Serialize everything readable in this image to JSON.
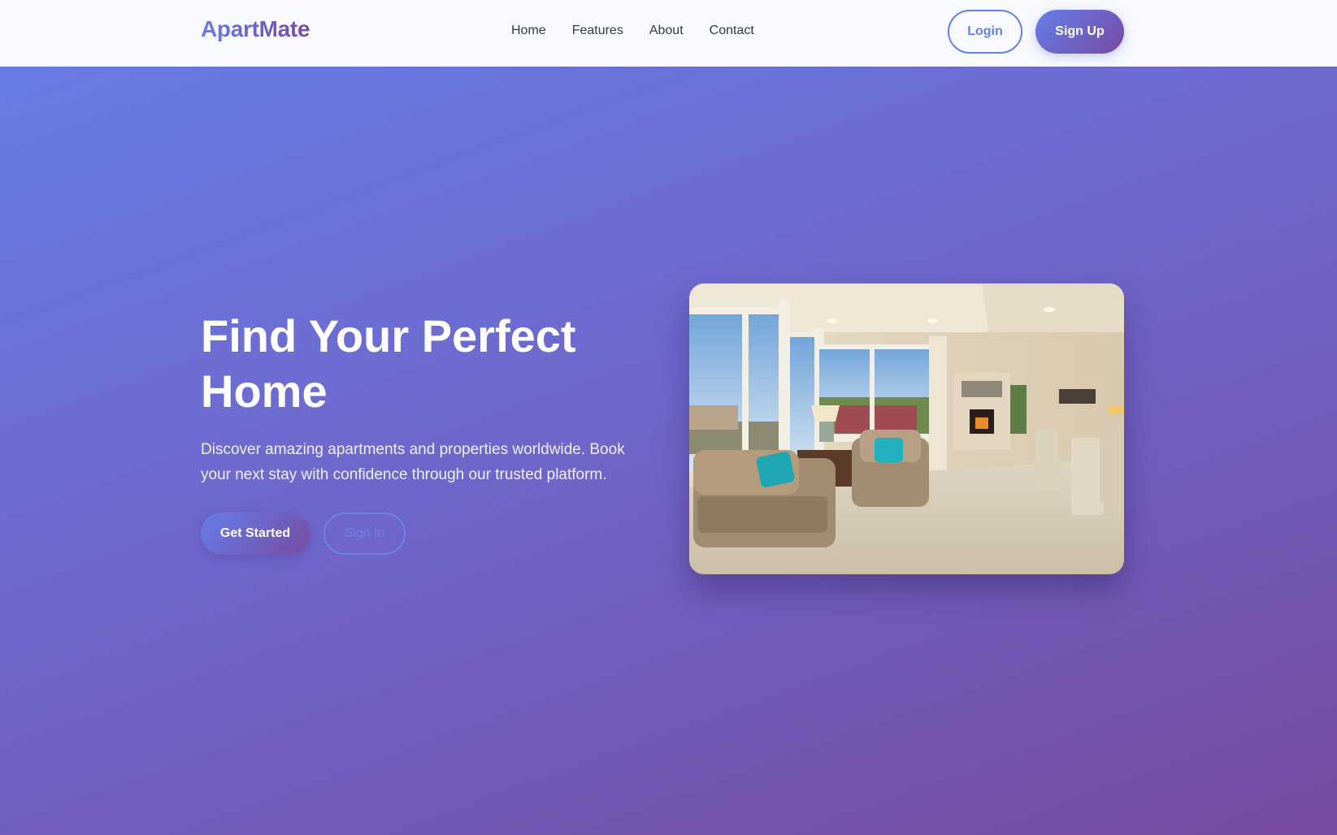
{
  "brand": {
    "name": "ApartMate"
  },
  "nav": {
    "links": [
      "Home",
      "Features",
      "About",
      "Contact"
    ],
    "login_label": "Login",
    "signup_label": "Sign Up"
  },
  "hero": {
    "title_line1": "Find Your Perfect",
    "title_line2": "Home",
    "subtitle": "Discover amazing apartments and properties worldwide. Book your next stay with confidence through our trusted platform.",
    "cta_primary": "Get Started",
    "cta_secondary": "Sign In"
  },
  "colors": {
    "gradient_start": "#667eea",
    "gradient_end": "#764ba2",
    "navbar_bg": "#f8f9fc"
  }
}
